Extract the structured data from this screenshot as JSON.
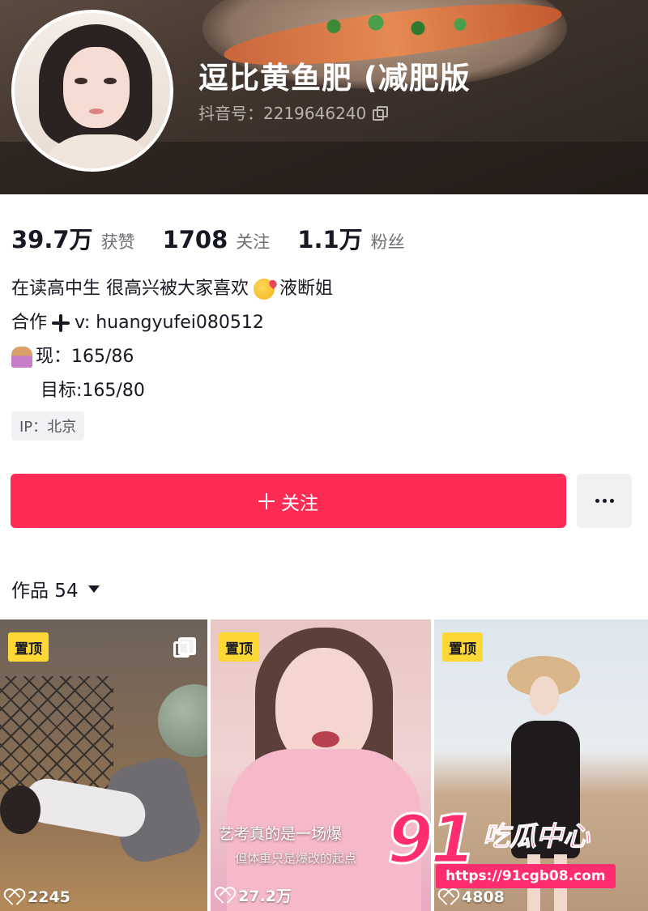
{
  "profile": {
    "nickname": "逗比黄鱼肥 (减肥版",
    "douyin_id": "抖音号：2219646240"
  },
  "stats": [
    {
      "value": "39.7万",
      "label": "获赞"
    },
    {
      "value": "1708",
      "label": "关注"
    },
    {
      "value": "1.1万",
      "label": "粉丝"
    }
  ],
  "bio": {
    "line1_text": "在读高中生 很高兴被大家喜欢",
    "line1_suffix": "液断姐",
    "line2_prefix": "合作",
    "line2_suffix": "v: huangyufei080512",
    "line3": "现：165/86",
    "line4": "目标:165/80"
  },
  "ip_location": "IP：北京",
  "actions": {
    "follow_label": "关注"
  },
  "works_tab": {
    "label": "作品 54"
  },
  "videos": [
    {
      "pinned_label": "置顶",
      "likes": "2245",
      "is_multi_image": true
    },
    {
      "pinned_label": "置顶",
      "likes": "27.2万",
      "caption": "艺考真的是一场爆",
      "caption2": "但体重只是爆改的起点"
    },
    {
      "pinned_label": "置顶",
      "likes": "4808"
    }
  ],
  "watermark": {
    "number": "91",
    "name": "吃瓜中心",
    "url": "https://91cgb08.com"
  },
  "colors": {
    "accent": "#fe2c55",
    "pin_badge": "#fdd835",
    "watermark": "#ff2d6f"
  },
  "icons": [
    "copy-icon",
    "plus-icon",
    "dropdown-caret-icon",
    "more-icon",
    "heart-icon",
    "multi-image-icon",
    "kiss-emoji-icon",
    "person-emoji-icon"
  ]
}
